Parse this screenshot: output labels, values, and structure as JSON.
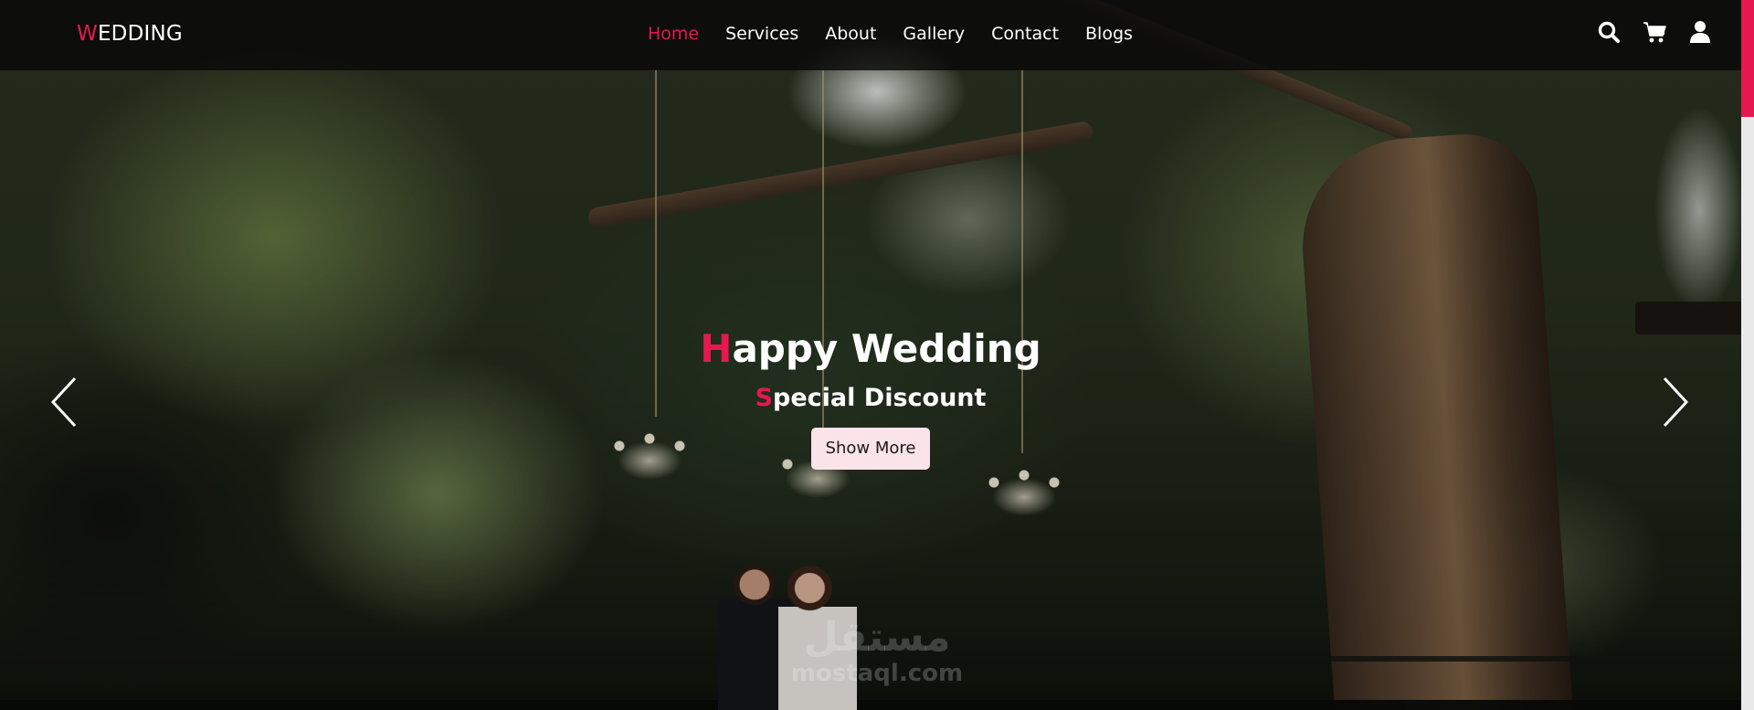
{
  "brand": {
    "first_letter": "W",
    "rest": "EDDING"
  },
  "nav": {
    "links": [
      {
        "label": "Home",
        "active": true
      },
      {
        "label": "Services",
        "active": false
      },
      {
        "label": "About",
        "active": false
      },
      {
        "label": "Gallery",
        "active": false
      },
      {
        "label": "Contact",
        "active": false
      },
      {
        "label": "Blogs",
        "active": false
      }
    ],
    "icons": [
      "search-icon",
      "cart-icon",
      "user-icon"
    ]
  },
  "hero": {
    "title_first_letter": "H",
    "title_rest": "appy Wedding",
    "subtitle_first_letter": "S",
    "subtitle_rest": "pecial Discount",
    "button_label": "Show More",
    "prev_icon": "chevron-left-icon",
    "next_icon": "chevron-right-icon"
  },
  "watermark": {
    "arabic": "مستقل",
    "latin": "mostaql.com"
  },
  "colors": {
    "accent": "#e5194f",
    "button_bg": "#fbe3ea",
    "navbar_bg": "#080808"
  }
}
